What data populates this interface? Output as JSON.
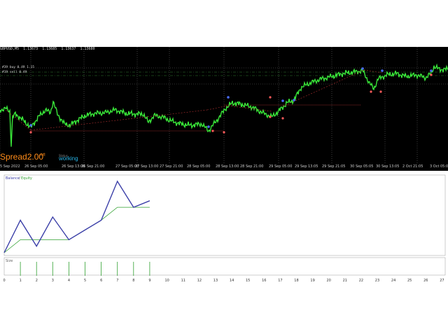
{
  "chart_window": {
    "symbol_title": "GBPUSD,M5",
    "prices": [
      "1.13673",
      "1.13685",
      "1.13637",
      "1.13680"
    ],
    "trade_lines": [
      "#39 buy 0.49 1.15",
      "#19 sell 0.49"
    ],
    "spread_label": "Spread",
    "spread_value": "2.00",
    "spread_sub": "点差",
    "status_mini": "Status",
    "status": "working",
    "time_labels": [
      "5 Sep 2022",
      "26 Sep 05:00",
      "26 Sep 13:00",
      "26 Sep 21:00",
      "27 Sep 05:00",
      "27 Sep 13:00",
      "27 Sep 21:00",
      "28 Sep 05:00",
      "28 Sep 13:00",
      "28 Sep 21:00",
      "29 Sep 05:00",
      "29 Sep 13:05",
      "29 Sep 21:05",
      "30 Sep 05:05",
      "30 Sep 13:05",
      "2 Oct 21:05",
      "3 Oct 05:05"
    ]
  },
  "report": {
    "balance_label": "Balance",
    "equity_label": "Equity",
    "size_label": "Size",
    "x_labels": [
      "0",
      "1",
      "2",
      "3",
      "4",
      "5",
      "6",
      "7",
      "8",
      "9",
      "10",
      "11",
      "12",
      "13",
      "14",
      "15",
      "16",
      "17",
      "18",
      "19",
      "20",
      "21",
      "22",
      "23",
      "24",
      "25",
      "26",
      "27"
    ]
  },
  "chart_data": [
    {
      "type": "line",
      "title": "",
      "series": [
        {
          "name": "Balance",
          "color": "#3b3fa8",
          "x": [
            0,
            1,
            2,
            3,
            4,
            5,
            6,
            7,
            8,
            9
          ],
          "values": [
            0,
            10,
            2,
            11,
            4,
            7,
            10,
            22,
            14,
            16
          ]
        },
        {
          "name": "Equity",
          "color": "#2fa02f",
          "x": [
            0,
            1,
            2,
            3,
            4,
            5,
            6,
            7,
            8,
            9
          ],
          "values": [
            0,
            4,
            4,
            4,
            4,
            7,
            10,
            14,
            14,
            14
          ]
        }
      ]
    },
    {
      "type": "bar",
      "title": "",
      "series": [
        {
          "name": "Size",
          "color": "#2fa02f",
          "x": [
            1,
            2,
            3,
            4,
            5,
            6,
            7,
            8,
            9
          ],
          "values": [
            1,
            1,
            1,
            1,
            1,
            1,
            1,
            1,
            1
          ]
        }
      ]
    }
  ],
  "colors": {
    "price_line": "#39e639",
    "grid_major": "#666666",
    "buy_marker": "#4a6cff",
    "sell_marker": "#ff5a5a",
    "spread": "#ff8c1a",
    "status": "#28b4e6"
  }
}
